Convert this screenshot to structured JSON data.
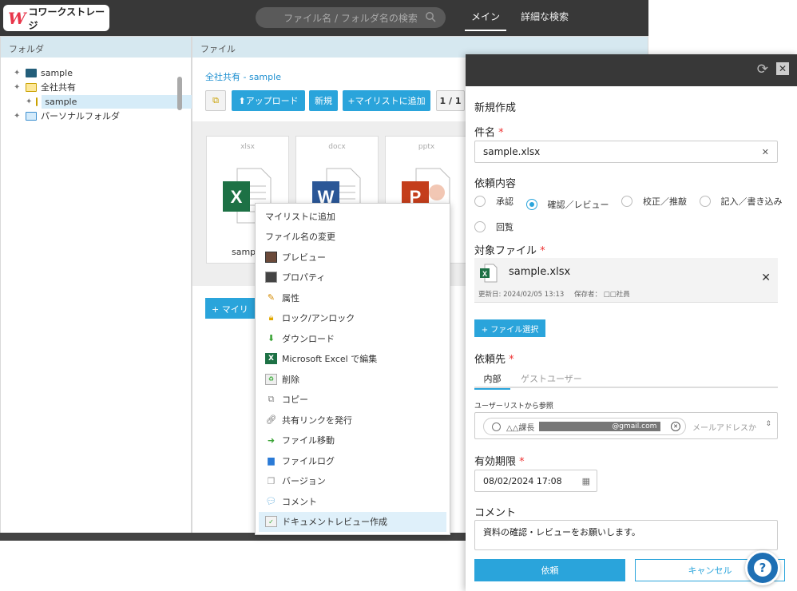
{
  "header": {
    "logo_mark": "W",
    "logo_text": "コワークストレージ",
    "search_placeholder": "ファイル名 / フォルダ名の検索",
    "nav_main": "メイン",
    "nav_advanced": "詳細な検索"
  },
  "folders": {
    "title": "フォルダ",
    "items": [
      {
        "label": "sample"
      },
      {
        "label": "全社共有"
      },
      {
        "label": "sample"
      },
      {
        "label": "パーソナルフォルダ"
      }
    ]
  },
  "files": {
    "title": "ファイル",
    "breadcrumb": "全社共有 - sample",
    "upload": "アップロード",
    "new": "新規",
    "add_mylist": "マイリストに追加",
    "page": "1 / 1",
    "cards": [
      {
        "ext": "xlsx",
        "name": "sample",
        "color": "#1d7145",
        "letter": "X"
      },
      {
        "ext": "docx",
        "name": "",
        "color": "#2b5797",
        "letter": "W"
      },
      {
        "ext": "pptx",
        "name": "",
        "color": "#c43e1c",
        "letter": "P"
      }
    ],
    "add_mylist_bottom": "+ マイリ"
  },
  "context_menu": [
    {
      "label": "マイリストに追加",
      "icon": ""
    },
    {
      "label": "ファイル名の変更",
      "icon": ""
    },
    {
      "label": "プレビュー",
      "icon": "preview-icon"
    },
    {
      "label": "プロパティ",
      "icon": "properties-icon"
    },
    {
      "label": "属性",
      "icon": "attribute-icon"
    },
    {
      "label": "ロック/アンロック",
      "icon": "lock-icon"
    },
    {
      "label": "ダウンロード",
      "icon": "download-icon"
    },
    {
      "label": "Microsoft Excel で編集",
      "icon": "excel-icon"
    },
    {
      "label": "削除",
      "icon": "trash-icon"
    },
    {
      "label": "コピー",
      "icon": "copy-icon"
    },
    {
      "label": "共有リンクを発行",
      "icon": "link-icon"
    },
    {
      "label": "ファイル移動",
      "icon": "move-icon"
    },
    {
      "label": "ファイルログ",
      "icon": "chart-icon"
    },
    {
      "label": "バージョン",
      "icon": "version-icon"
    },
    {
      "label": "コメント",
      "icon": "comment-icon"
    },
    {
      "label": "ドキュメントレビュー作成",
      "icon": "review-icon"
    }
  ],
  "modal": {
    "title": "新規作成",
    "subject_label": "件名",
    "subject_value": "sample.xlsx",
    "content_label": "依頼内容",
    "options": [
      "承認",
      "確認／レビュー",
      "校正／推敲",
      "記入／書き込み",
      "回覧"
    ],
    "selected_option": "確認／レビュー",
    "target_label": "対象ファイル",
    "file_name": "sample.xlsx",
    "file_updated": "更新日: 2024/02/05 13:13",
    "file_owner": "保存者：  □□社員",
    "file_select": "+ ファイル選択",
    "to_label": "依頼先",
    "tab_internal": "内部",
    "tab_guest": "ゲストユーザー",
    "userlist_label": "ユーザーリストから参照",
    "user_chip_name": "△△課長",
    "user_chip_email": "@gmail.com",
    "email_placeholder": "メールアドレスか",
    "deadline_label": "有効期限",
    "deadline_value": "08/02/2024 17:08",
    "comment_label": "コメント",
    "comment_value": "資料の確認・レビューをお願いします。",
    "submit": "依頼",
    "cancel": "キャンセル"
  },
  "colors": {
    "accent": "#2aa4db",
    "header": "#383838",
    "required": "#e33333"
  }
}
